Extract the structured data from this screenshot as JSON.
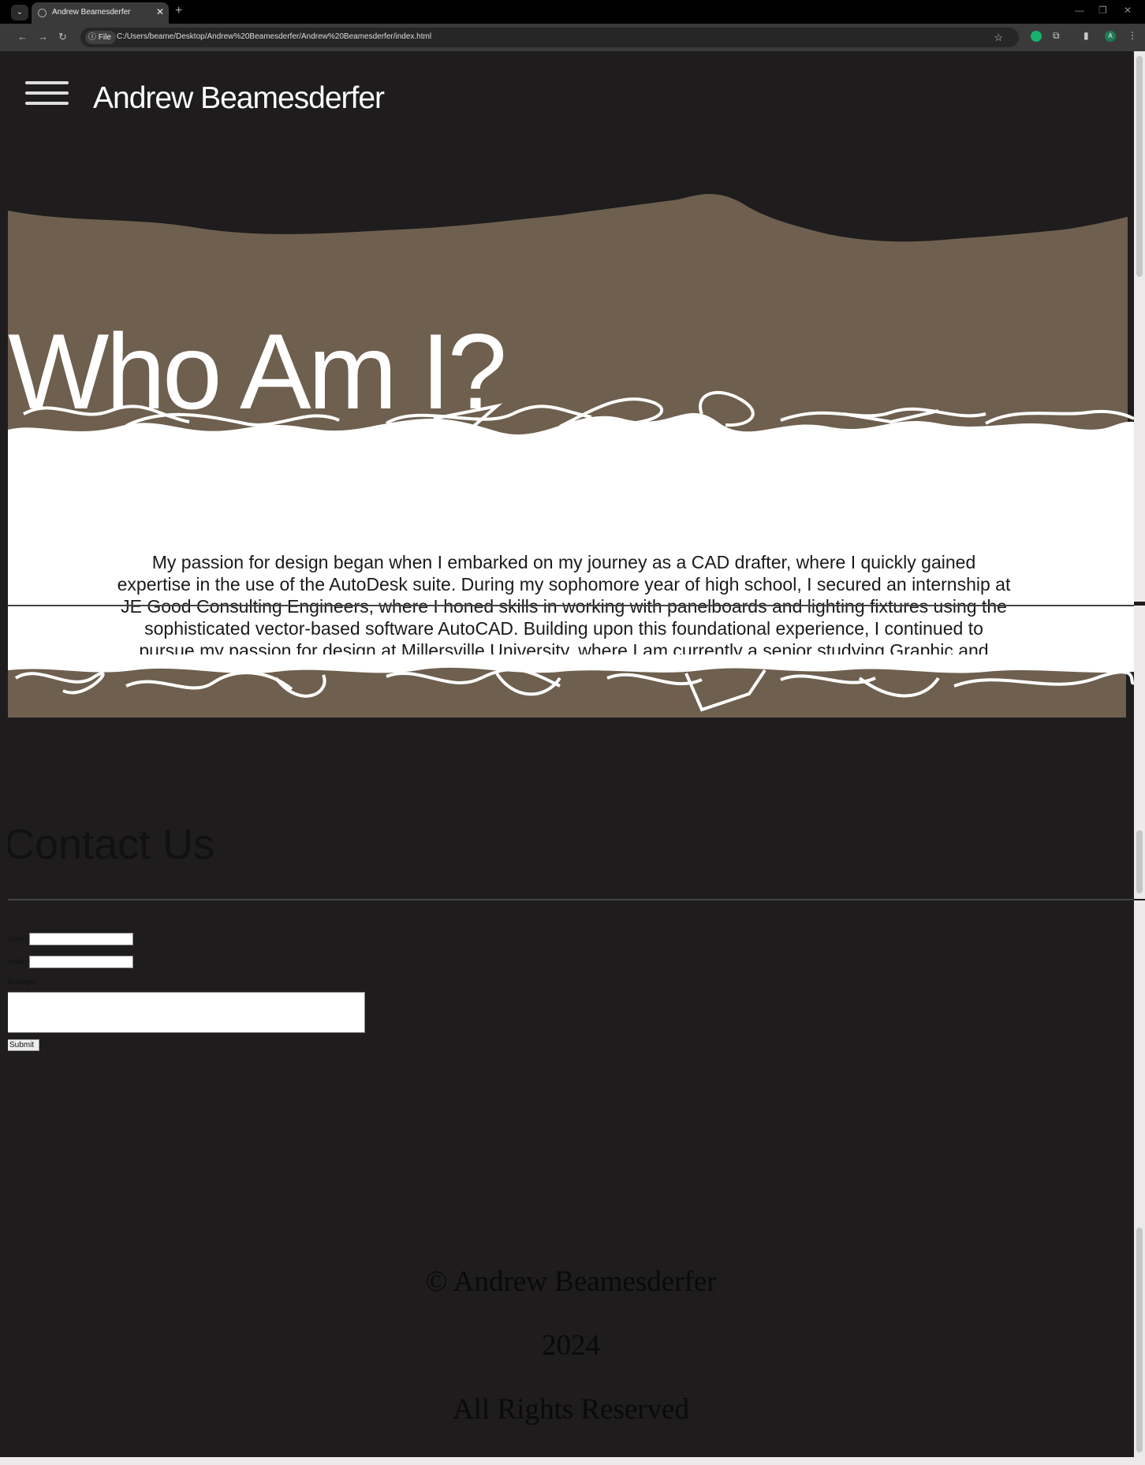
{
  "browser": {
    "tab_title": "Andrew Beamesderfer",
    "file_label": "File",
    "url": "C:/Users/beame/Desktop/Andrew%20Beamesderfer/Andrew%20Beamesderfer/index.html",
    "profile_initial": "A"
  },
  "header": {
    "site_name": "Andrew Beamesderfer"
  },
  "hero": {
    "title": "Who Am I?"
  },
  "about": {
    "text": "My passion for design began when I embarked on my journey as a CAD drafter, where I quickly gained expertise in the use of the AutoDesk suite. During my sophomore year of high school, I secured an internship at JE Good Consulting Engineers, where I honed skills in working with panelboards and lighting fixtures using the sophisticated vector-based software AutoCAD. Building upon this foundational experience, I continued to pursue my passion for design at Millersville University, where I am currently a senior studying Graphic and Interactive Design."
  },
  "contact": {
    "title": "Contact Us",
    "name_label": "Name:",
    "email_label": "Email:",
    "message_label": "Message:",
    "submit_label": "Submit"
  },
  "footer": {
    "line1": "© Andrew Beamesderfer",
    "line2": "2024",
    "line3": "All Rights Reserved"
  },
  "colors": {
    "page_bg": "#1e1c1d",
    "brown": "#6e5f4f",
    "white": "#ffffff"
  }
}
